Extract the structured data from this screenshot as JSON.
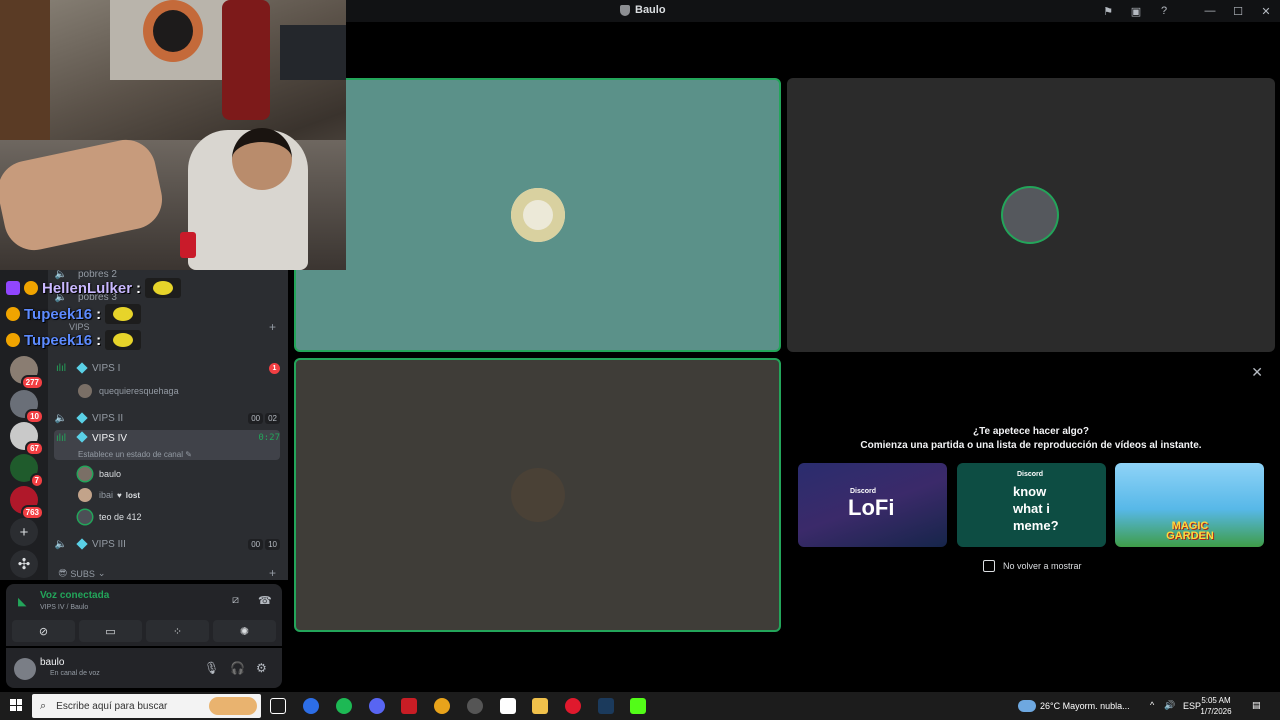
{
  "window": {
    "title": "Baulo"
  },
  "chat": [
    {
      "user": "HellenLulker",
      "badge_count": "1"
    },
    {
      "user": "Tupeek16"
    },
    {
      "user": "Tupeek16"
    }
  ],
  "servers": [
    {
      "count": "277"
    },
    {
      "count": "10"
    },
    {
      "count": "67"
    },
    {
      "count": "7"
    },
    {
      "count": "763"
    }
  ],
  "channels": {
    "pobres2": "pobres 2",
    "pobres3": "pobres 3",
    "vips_cat": "VIPS",
    "vips1": {
      "name": "VIPS I",
      "badge": "1"
    },
    "vips1_member": "quequieresquehaga",
    "vips2": {
      "name": "VIPS II",
      "left": "00",
      "right": "02"
    },
    "vips4": {
      "name": "VIPS IV",
      "timer": "0:27",
      "status": "Establece un estado de canal"
    },
    "vips4_members": [
      {
        "name": "baulo",
        "extra": ""
      },
      {
        "name": "ibai",
        "extra": "lost"
      },
      {
        "name": "teo de 412",
        "extra": ""
      }
    ],
    "vips3": {
      "name": "VIPS III",
      "left": "00",
      "right": "10"
    },
    "subs_cat": "SUBS"
  },
  "voice": {
    "title": "Voz conectada",
    "subtitle": "VIPS IV / Baulo"
  },
  "user": {
    "name": "baulo",
    "status": "En canal de voz"
  },
  "activity": {
    "heading": "¿Te apetece hacer algo?",
    "subheading": "Comienza una partida o una lista de reproducción de vídeos al instante.",
    "cards": [
      {
        "tag": "Discord",
        "title": "LoFi"
      },
      {
        "tag": "Discord",
        "title": "know what i meme?"
      },
      {
        "tag": "",
        "title": "MAGIC GARDEN"
      }
    ],
    "checkbox": "No volver a mostrar"
  },
  "taskbar": {
    "search_placeholder": "Escribe aquí para buscar",
    "weather": "26°C  Mayorm. nubla...",
    "lang": "ESP",
    "time": "5:05 AM",
    "date": "1/7/2026"
  },
  "colors": {
    "speaking": "#23a55a",
    "accent": "#5865f2",
    "danger": "#f23f43"
  }
}
